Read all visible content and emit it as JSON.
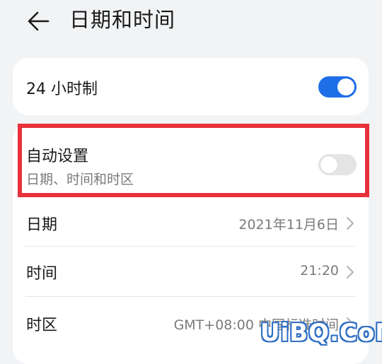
{
  "header": {
    "title": "日期和时间",
    "back_icon": "arrow-left-icon"
  },
  "settings": {
    "hour24": {
      "label": "24 小时制",
      "enabled": true
    },
    "auto_set": {
      "label": "自动设置",
      "sublabel": "日期、时间和时区",
      "enabled": false
    },
    "date": {
      "label": "日期",
      "value": "2021年11月6日"
    },
    "time": {
      "label": "时间",
      "value": "21:20"
    },
    "timezone": {
      "label": "时区",
      "value": "GMT+08:00 中国标准时间"
    }
  },
  "colors": {
    "accent": "#1e6ee8",
    "highlight": "#e8313b",
    "background": "#f1f3f5"
  },
  "watermark": "UiBQ.CoM"
}
